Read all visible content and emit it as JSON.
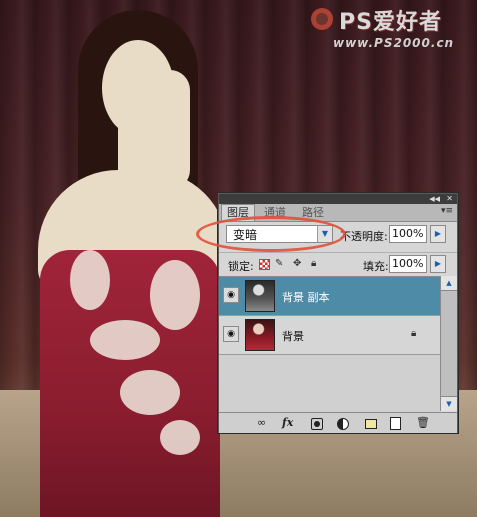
{
  "watermark": {
    "title": "PS爱好者",
    "url": "www.PS2000.cn"
  },
  "panel": {
    "tabs": [
      "图层",
      "通道",
      "路径"
    ],
    "active_tab": "图层",
    "blend_mode": "变暗",
    "opacity_label": "不透明度:",
    "opacity_value": "100%",
    "lock_label": "锁定:",
    "fill_label": "填充:",
    "fill_value": "100%",
    "layers": [
      {
        "name": "背景 副本",
        "selected": true,
        "visible": true,
        "locked": false
      },
      {
        "name": "背景",
        "selected": false,
        "visible": true,
        "locked": true
      }
    ],
    "icons": {
      "collapse": "collapse-icon",
      "close": "close-icon",
      "menu": "panel-menu-icon",
      "link": "link-icon",
      "fx": "fx-icon",
      "mask": "mask-icon",
      "adjustment": "adjustment-icon",
      "group": "group-icon",
      "new_layer": "new-layer-icon",
      "trash": "trash-icon"
    },
    "fx_label": "fx"
  },
  "colors": {
    "selected_layer": "#4d8ba6",
    "highlight": "#e0503a",
    "panel_bg": "#d6d6d6"
  }
}
